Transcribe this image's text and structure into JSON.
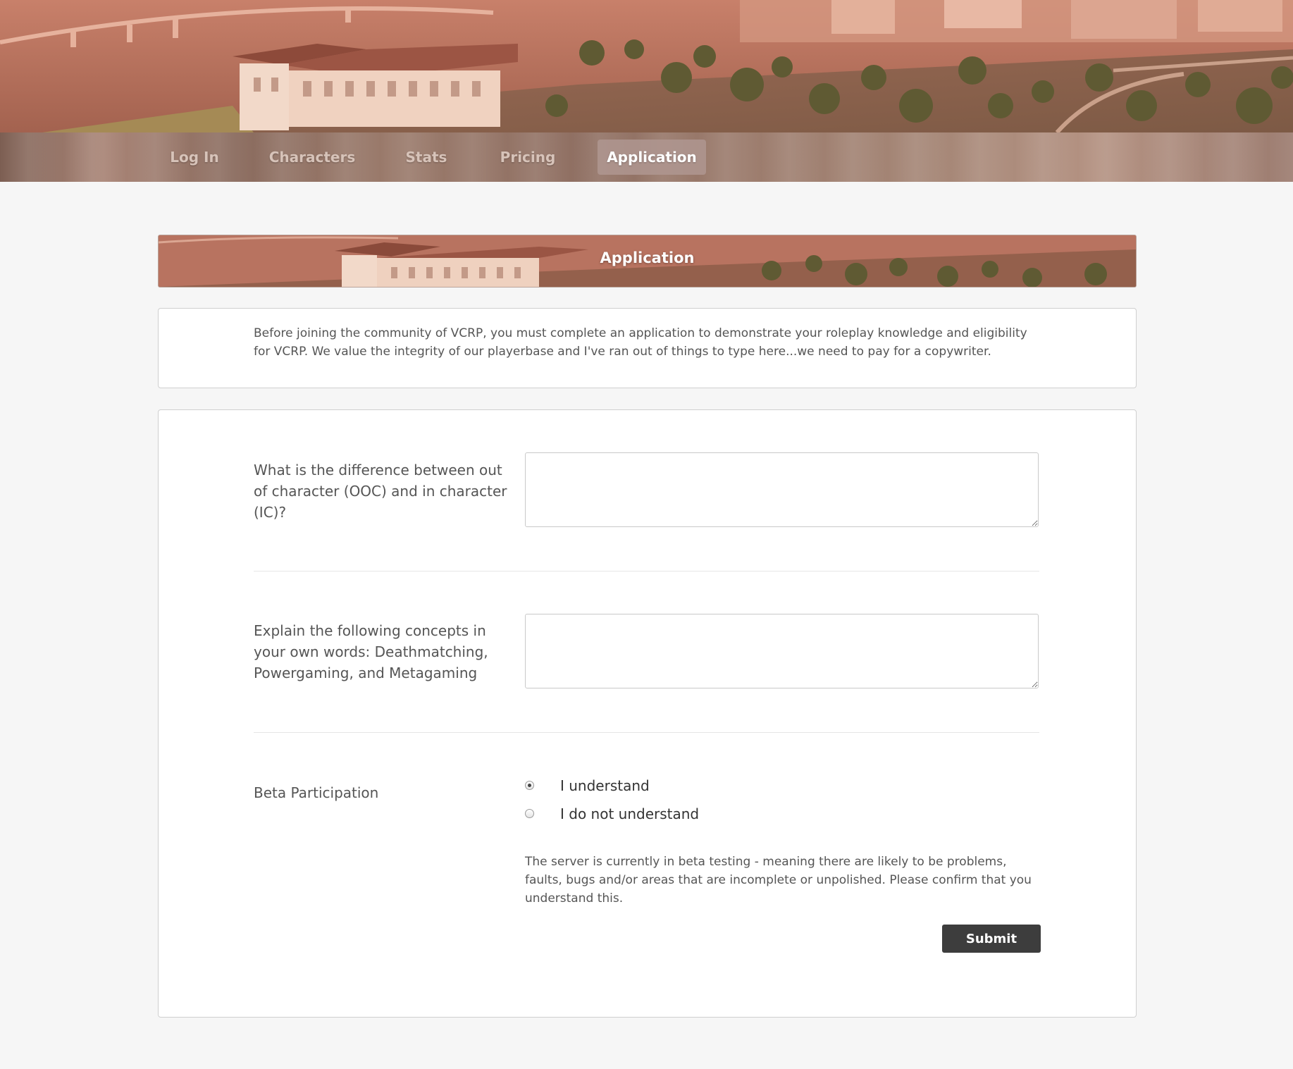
{
  "nav": {
    "items": [
      {
        "label": "Log In",
        "active": false
      },
      {
        "label": "Characters",
        "active": false
      },
      {
        "label": "Stats",
        "active": false
      },
      {
        "label": "Pricing",
        "active": false
      },
      {
        "label": "Application",
        "active": true
      }
    ]
  },
  "banner": {
    "title": "Application"
  },
  "intro": {
    "text": "Before joining the community of VCRP, you must complete an application to demonstrate your roleplay knowledge and eligibility for VCRP. We value the integrity of our playerbase and I've ran out of things to type here...we need to pay for a copywriter."
  },
  "form": {
    "questions": [
      {
        "label": "What is the difference between out of character (OOC) and in character (IC)?",
        "value": ""
      },
      {
        "label": "Explain the following concepts in your own words: Deathmatching, Powergaming, and Metagaming",
        "value": ""
      }
    ],
    "beta": {
      "label": "Beta Participation",
      "options": [
        {
          "label": "I understand",
          "checked": true
        },
        {
          "label": "I do not understand",
          "checked": false
        }
      ],
      "note": "The server is currently in beta testing - meaning there are likely to be problems, faults, bugs and/or areas that are incomplete or unpolished. Please confirm that you understand this."
    },
    "submit_label": "Submit"
  },
  "colors": {
    "active_tab": "#af9691",
    "submit_bg": "#3d3d3d",
    "page_bg": "#f6f6f6"
  }
}
